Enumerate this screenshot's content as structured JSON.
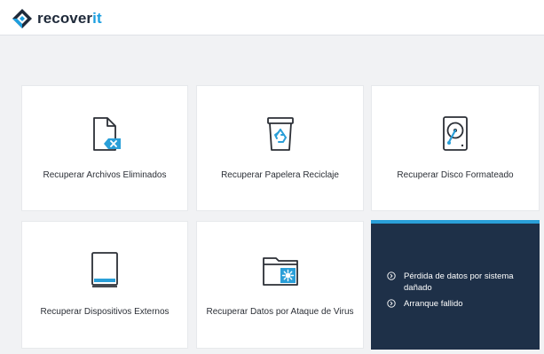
{
  "app": {
    "logo_prefix": "recover",
    "logo_suffix": "it",
    "accent_color": "#1c9fe0"
  },
  "cards": [
    {
      "label": "Recuperar Archivos Eliminados",
      "icon": "deleted-file-icon"
    },
    {
      "label": "Recuperar Papelera Reciclaje",
      "icon": "recycle-bin-icon"
    },
    {
      "label": "Recuperar Disco Formateado",
      "icon": "formatted-disk-icon"
    },
    {
      "label": "Recuperar Dispositivos Externos",
      "icon": "external-device-icon"
    },
    {
      "label": "Recuperar Datos por Ataque de Virus",
      "icon": "virus-folder-icon"
    }
  ],
  "more_panel": {
    "items": [
      {
        "label": "Pérdida de datos por sistema dañado",
        "icon": "chevron-circle-icon"
      },
      {
        "label": "Arranque fallido",
        "icon": "chevron-circle-icon"
      }
    ],
    "background": "#1e3048",
    "accent": "#2a9fd8"
  }
}
